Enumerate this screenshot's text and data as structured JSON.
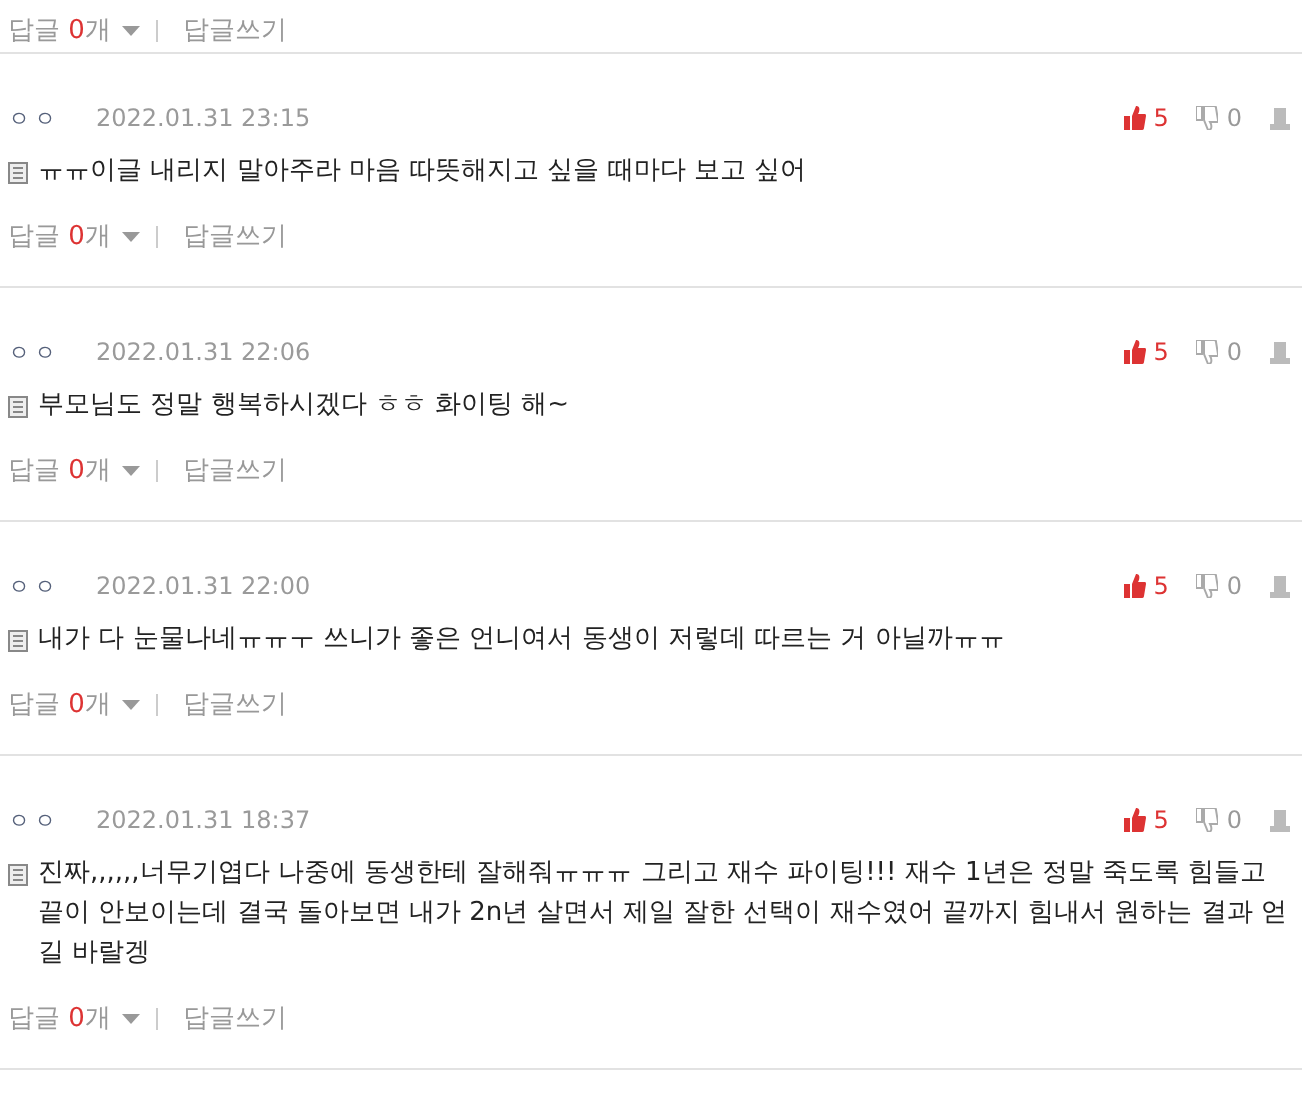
{
  "top_reply_bar": {
    "reply_label": "답글",
    "reply_count": "0",
    "reply_unit": "개",
    "write_label": "답글쓰기"
  },
  "comments": [
    {
      "author": "ㅇㅇ",
      "date": "2022.01.31 23:15",
      "likes": "5",
      "dislikes": "0",
      "text": "ㅠㅠ이글 내리지 말아주라 마음 따뜻해지고 싶을 때마다 보고 싶어",
      "reply_label": "답글",
      "reply_count": "0",
      "reply_unit": "개",
      "write_label": "답글쓰기"
    },
    {
      "author": "ㅇㅇ",
      "date": "2022.01.31 22:06",
      "likes": "5",
      "dislikes": "0",
      "text": "부모님도 정말 행복하시겠다 ㅎㅎ 화이팅 해~",
      "reply_label": "답글",
      "reply_count": "0",
      "reply_unit": "개",
      "write_label": "답글쓰기"
    },
    {
      "author": "ㅇㅇ",
      "date": "2022.01.31 22:00",
      "likes": "5",
      "dislikes": "0",
      "text": "내가 다 눈물나네ㅠㅠㅜ 쓰니가 좋은 언니여서 동생이 저렇데 따르는 거 아닐까ㅠㅠ",
      "reply_label": "답글",
      "reply_count": "0",
      "reply_unit": "개",
      "write_label": "답글쓰기"
    },
    {
      "author": "ㅇㅇ",
      "date": "2022.01.31 18:37",
      "likes": "5",
      "dislikes": "0",
      "text": "진짜,,,,,,너무기엽다 나중에 동생한테 잘해줘ㅠㅠㅠ 그리고 재수 파이팅!!! 재수 1년은 정말 죽도록 힘들고 끝이 안보이는데 결국 돌아보면 내가 2n년 살면서 제일 잘한 선택이 재수였어 끝까지 힘내서 원하는 결과 얻길 바랄겡",
      "reply_label": "답글",
      "reply_count": "0",
      "reply_unit": "개",
      "write_label": "답글쓰기"
    }
  ]
}
